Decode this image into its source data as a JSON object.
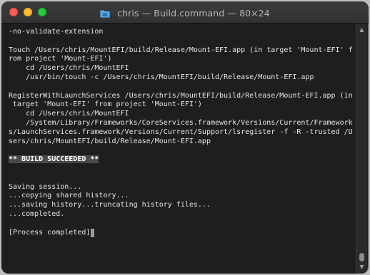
{
  "window": {
    "title": "chris — Build.command — 80×24",
    "title_icon": "folder-icon"
  },
  "terminal": {
    "lines": [
      "-no-validate-extension",
      "",
      "Touch /Users/chris/MountEFI/build/Release/Mount-EFI.app (in target 'Mount-EFI' f",
      "rom project 'Mount-EFI')",
      "    cd /Users/chris/MountEFI",
      "    /usr/bin/touch -c /Users/chris/MountEFI/build/Release/Mount-EFI.app",
      "",
      "RegisterWithLaunchServices /Users/chris/MountEFI/build/Release/Mount-EFI.app (in",
      " target 'Mount-EFI' from project 'Mount-EFI')",
      "    cd /Users/chris/MountEFI",
      "    /System/Library/Frameworks/CoreServices.framework/Versions/Current/Framework",
      "s/LaunchServices.framework/Versions/Current/Support/lsregister -f -R -trusted /U",
      "sers/chris/MountEFI/build/Release/Mount-EFI.app",
      "",
      "** BUILD SUCCEEDED **",
      "",
      "",
      "Saving session...",
      "...copying shared history...",
      "...saving history...truncating history files...",
      "...completed.",
      "",
      "[Process completed]"
    ]
  },
  "colors": {
    "background": "#1e1e1e",
    "text": "#e6e6e6",
    "highlight_bg": "#4a4a4a",
    "close": "#ff5f57",
    "minimize": "#febc2e",
    "maximize": "#28c840",
    "folder": "#5aa9e6"
  }
}
